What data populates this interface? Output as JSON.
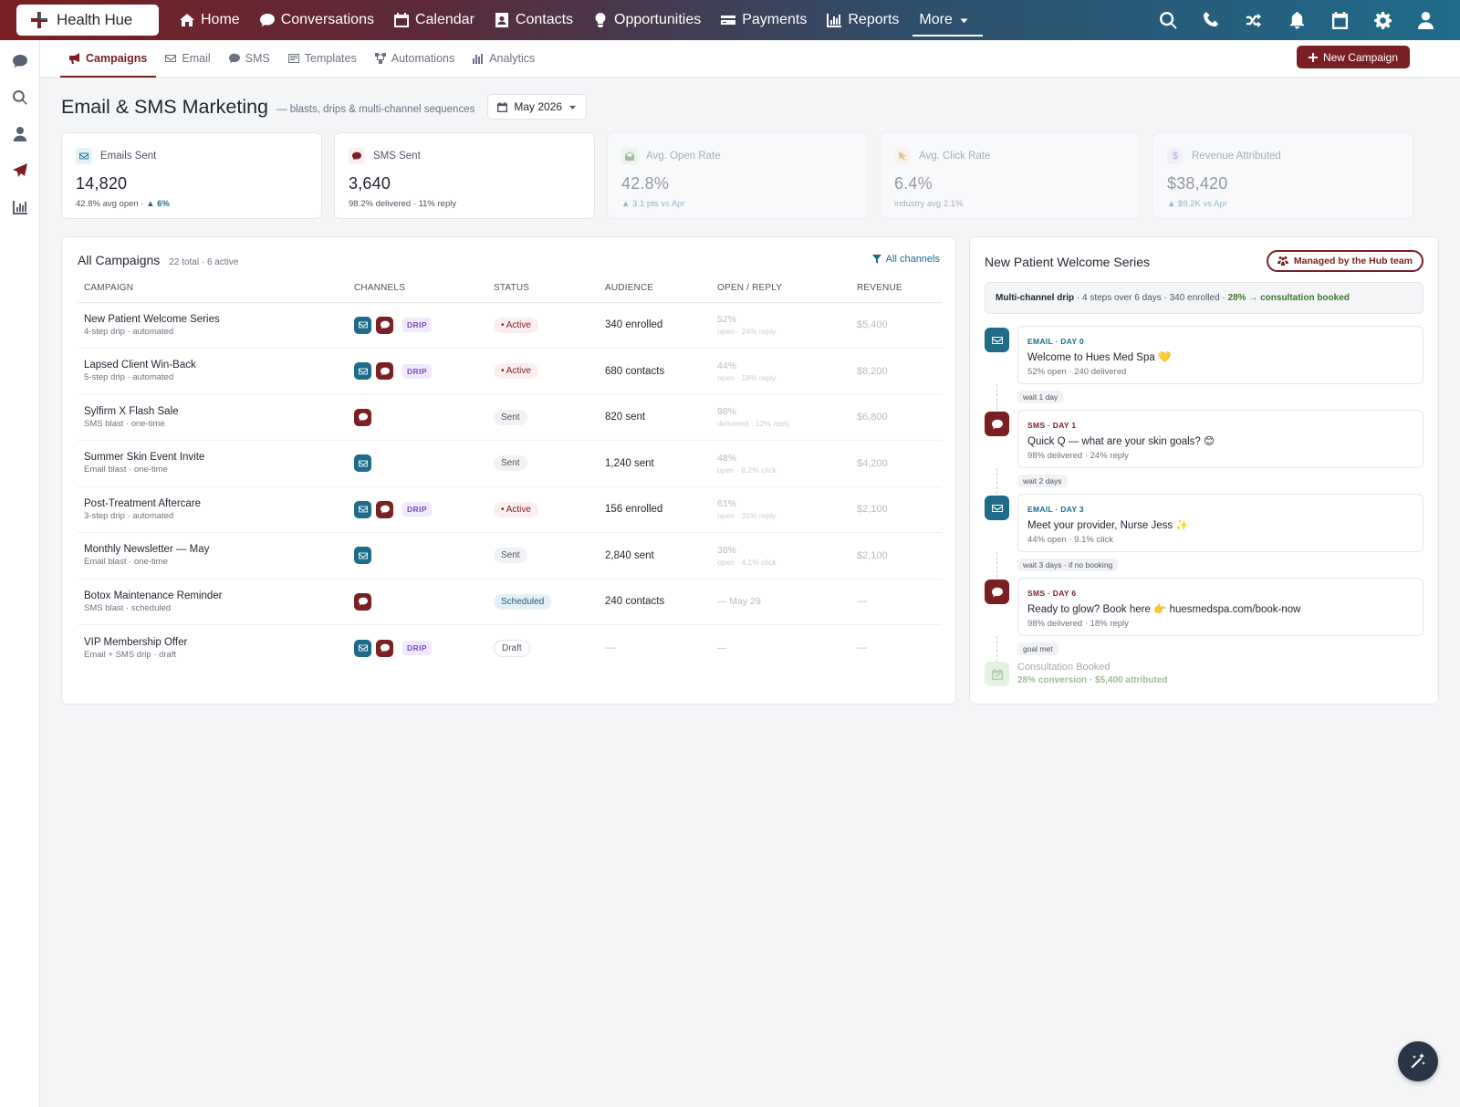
{
  "app": {
    "name": "Health Hue"
  },
  "nav": {
    "items": [
      {
        "label": "Home",
        "icon": "home-icon"
      },
      {
        "label": "Conversations",
        "icon": "chat-bubble-icon"
      },
      {
        "label": "Calendar",
        "icon": "calendar-icon"
      },
      {
        "label": "Contacts",
        "icon": "contact-card-icon"
      },
      {
        "label": "Opportunities",
        "icon": "lightbulb-icon"
      },
      {
        "label": "Payments",
        "icon": "credit-card-icon"
      },
      {
        "label": "Reports",
        "icon": "bar-chart-icon"
      },
      {
        "label": "More",
        "icon": "caret-down-icon"
      }
    ]
  },
  "subnav": {
    "tabs": [
      {
        "label": "Campaigns",
        "active": true
      },
      {
        "label": "Email"
      },
      {
        "label": "SMS"
      },
      {
        "label": "Templates"
      },
      {
        "label": "Automations"
      },
      {
        "label": "Analytics"
      }
    ],
    "new_button": "New Campaign"
  },
  "header": {
    "title": "Email & SMS Marketing",
    "subtitle": "— blasts, drips & multi-channel sequences",
    "month": "May 2026"
  },
  "stats": [
    {
      "label": "Emails Sent",
      "value": "14,820",
      "foot": "42.8% avg open · ",
      "delta": "▲ 6%"
    },
    {
      "label": "SMS Sent",
      "value": "3,640",
      "foot": "98.2% delivered · 11% reply",
      "delta": ""
    },
    {
      "label": "Avg. Open Rate",
      "value": "42.8%",
      "foot": "▲ 3.1 pts vs Apr",
      "delta": ""
    },
    {
      "label": "Avg. Click Rate",
      "value": "6.4%",
      "foot": "industry avg 2.1%",
      "delta": ""
    },
    {
      "label": "Revenue Attributed",
      "value": "$38,420",
      "foot": "▲ $9.2K vs Apr",
      "delta": ""
    }
  ],
  "campaigns": {
    "title": "All Campaigns",
    "meta": "22 total · 6 active",
    "filter": "All channels",
    "columns": [
      "CAMPAIGN",
      "CHANNELS",
      "STATUS",
      "AUDIENCE",
      "OPEN / REPLY",
      "REVENUE"
    ],
    "drip_label": "DRIP",
    "rows": [
      {
        "name": "New Patient Welcome Series",
        "sub": "4-step drip · automated",
        "status": "• Active",
        "audience": "340 enrolled",
        "rate": "52%",
        "rate_sub": "open · 24% reply",
        "revenue": "$5,400"
      },
      {
        "name": "Lapsed Client Win-Back",
        "sub": "5-step drip · automated",
        "status": "• Active",
        "audience": "680 contacts",
        "rate": "44%",
        "rate_sub": "open · 18% reply",
        "revenue": "$8,200"
      },
      {
        "name": "Sylfirm X Flash Sale",
        "sub": "SMS blast · one-time",
        "status": "Sent",
        "audience": "820 sent",
        "rate": "98%",
        "rate_sub": "delivered · 12% reply",
        "revenue": "$6,800"
      },
      {
        "name": "Summer Skin Event Invite",
        "sub": "Email blast · one-time",
        "status": "Sent",
        "audience": "1,240 sent",
        "rate": "48%",
        "rate_sub": "open · 8.2% click",
        "revenue": "$4,200"
      },
      {
        "name": "Post-Treatment Aftercare",
        "sub": "3-step drip · automated",
        "status": "• Active",
        "audience": "156 enrolled",
        "rate": "61%",
        "rate_sub": "open · 31% reply",
        "revenue": "$2,100"
      },
      {
        "name": "Monthly Newsletter — May",
        "sub": "Email blast · one-time",
        "status": "Sent",
        "audience": "2,840 sent",
        "rate": "38%",
        "rate_sub": "open · 4.1% click",
        "revenue": "$2,100"
      },
      {
        "name": "Botox Maintenance Reminder",
        "sub": "SMS blast · scheduled",
        "status": "Scheduled",
        "audience": "240 contacts",
        "rate": "— May 29",
        "rate_sub": "",
        "revenue": "—"
      },
      {
        "name": "VIP Membership Offer",
        "sub": "Email + SMS drip · draft",
        "status": "Draft",
        "audience": "—",
        "rate": "—",
        "rate_sub": "",
        "revenue": "—"
      }
    ]
  },
  "drip": {
    "title": "New Patient Welcome Series",
    "managed": "Managed by the Hub team",
    "summary_label": "Multi-channel drip",
    "summary_text": " · 4 steps over 6 days · 340 enrolled · ",
    "summary_goal": "28% → consultation booked",
    "steps": [
      {
        "label": "EMAIL · DAY 0",
        "title": "Welcome to Hues Med Spa 💛",
        "stat": "52% open · 240 delivered"
      },
      {
        "label": "SMS · DAY 1",
        "title": "Quick Q — what are your skin goals? 😊",
        "stat": "98% delivered · 24% reply"
      },
      {
        "label": "EMAIL · DAY 3",
        "title": "Meet your provider, Nurse Jess ✨",
        "stat": "44% open · 9.1% click"
      },
      {
        "label": "SMS · DAY 6",
        "title": "Ready to glow? Book here 👉 huesmedspa.com/book-now",
        "stat": "98% delivered · 18% reply"
      }
    ],
    "waits": [
      "wait 1 day",
      "wait 2 days",
      "wait 3 days · if no booking",
      "goal met"
    ],
    "goal_title": "Consultation Booked",
    "goal_sub": "28% conversion · $5,400 attributed"
  },
  "colors": {
    "brand": "#7a1f24",
    "teal": "#1f6b8a",
    "green": "#3d7a2c"
  }
}
